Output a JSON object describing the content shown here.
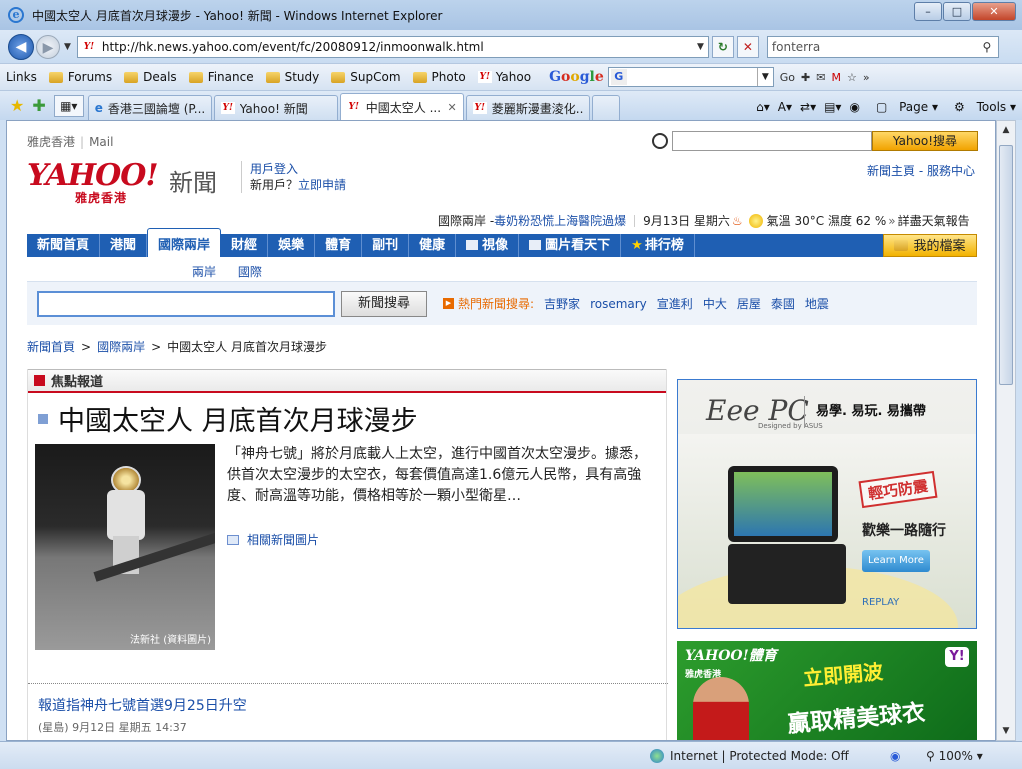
{
  "window": {
    "title": "中國太空人 月底首次月球漫步 - Yahoo! 新聞 - Windows Internet Explorer",
    "minimize": "–",
    "maximize": "□",
    "close": "✕"
  },
  "address_bar": {
    "url": "http://hk.news.yahoo.com/event/fc/20080912/inmoonwalk.html",
    "search_value": "fonterra"
  },
  "links_bar": {
    "label": "Links",
    "items": [
      "Forums",
      "Deals",
      "Finance",
      "Study",
      "SupCom",
      "Photo",
      "Yahoo"
    ],
    "google_go": "Go"
  },
  "tabs": [
    {
      "label": "香港三國論壇 (P...",
      "active": false
    },
    {
      "label": "Yahoo! 新聞",
      "active": false
    },
    {
      "label": "中國太空人 ...",
      "active": true
    },
    {
      "label": "菱麗斯漫畫淩化...",
      "active": false
    }
  ],
  "command_bar": {
    "page": "Page",
    "tools": "Tools"
  },
  "status_bar": {
    "zone": "Internet | Protected Mode: Off",
    "zoom": "100%"
  },
  "page": {
    "topnav": {
      "hk": "雅虎香港",
      "mail": "Mail"
    },
    "search_button": "Yahoo!搜尋",
    "logo": {
      "yahoo": "YAHOO!",
      "hk": "雅虎香港",
      "news": "新聞"
    },
    "login": {
      "login": "用戶登入",
      "new_user": "新用戶？",
      "register": "立即申請"
    },
    "top_right": "新聞主頁 - 服務中心",
    "headline": {
      "section": "國際兩岸 -",
      "text": "毒奶粉恐慌上海醫院過爆",
      "date": "9月13日 星期六",
      "weather": "氣溫 30°C 濕度 62 %",
      "weather_link": "詳盡天氣報告"
    },
    "nav": [
      "新聞首頁",
      "港聞",
      "國際兩岸",
      "財經",
      "娛樂",
      "體育",
      "副刊",
      "健康",
      "視像",
      "圖片看天下",
      "排行榜"
    ],
    "my_files": "我的檔案",
    "subnav": [
      "兩岸",
      "國際"
    ],
    "news_search_button": "新聞搜尋",
    "hot_search": {
      "label": "熱門新聞搜尋:",
      "keywords": [
        "吉野家",
        "rosemary",
        "宣進利",
        "中大",
        "居屋",
        "泰國",
        "地震"
      ]
    },
    "breadcrumb": [
      "新聞首頁",
      "國際兩岸",
      "中國太空人 月底首次月球漫步"
    ],
    "focus": {
      "header": "焦點報道",
      "title": "中國太空人 月底首次月球漫步",
      "photo_credit": "法新社 (資料圖片)",
      "summary": "「神舟七號」將於月底載人上太空，進行中國首次太空漫步。據悉，供首次太空漫步的太空衣，每套價值高達1.6億元人民幣，具有高強度、耐高溫等功能，價格相等於一顆小型衛星…",
      "related": "相關新聞圖片",
      "next_title": "報道指神舟七號首選9月25日升空",
      "next_meta": "(星島) 9月12日 星期五 14:37"
    },
    "ad_eee": {
      "brand": "Eee PC",
      "brand_sub": "Designed by ASUS",
      "tagline": "易學. 易玩. 易攜帶",
      "stamp": "輕巧防震",
      "slogan": "歡樂一路隨行",
      "learn_more": "Learn More",
      "replay": "REPLAY"
    },
    "ad_sport": {
      "logo": "YAHOO!體育",
      "logo_sub": "雅虎香港",
      "badge": "Y!",
      "line1": "立即開波",
      "line2": "贏取精美球衣"
    }
  }
}
